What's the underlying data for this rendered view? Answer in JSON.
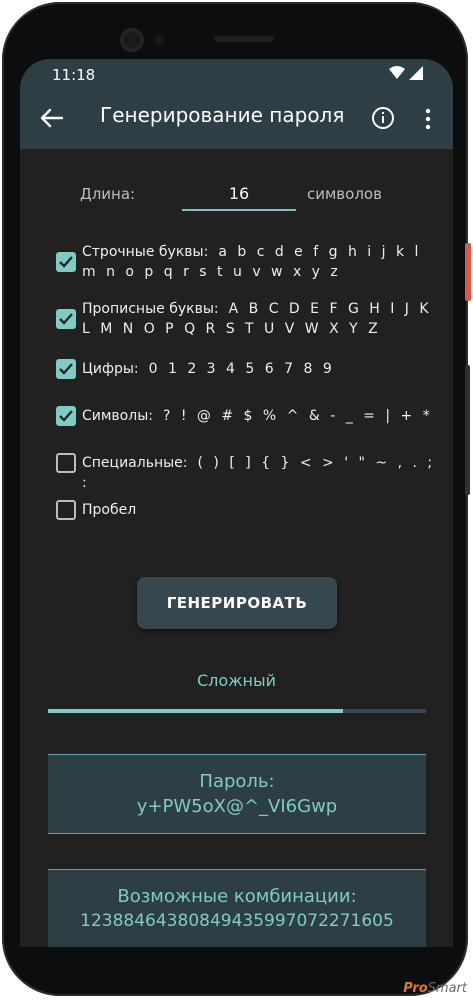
{
  "status_bar": {
    "time": "11:18"
  },
  "app_bar": {
    "title": "Генерирование пароля"
  },
  "length": {
    "label": "Длина:",
    "value": "16",
    "suffix": "символов"
  },
  "options": [
    {
      "label": "Строчные буквы:",
      "chars": "a b c d e f g h i j k l m n o p q r s t u v w x y z",
      "checked": true
    },
    {
      "label": "Прописные буквы:",
      "chars": "A B C D E F G H I J K L M N O P Q R S T U V W X Y Z",
      "checked": true
    },
    {
      "label": "Цифры:",
      "chars": "0 1 2 3 4 5 6 7 8 9",
      "checked": true
    },
    {
      "label": "Символы:",
      "chars": "? ! @ # $ % ^ & - _ = | + *",
      "checked": true
    },
    {
      "label": "Специальные:",
      "chars": "( ) [ ] { } < > ' \" ~ , . ; :",
      "checked": false
    },
    {
      "label": "Пробел",
      "chars": "",
      "checked": false
    }
  ],
  "generate_button": {
    "label": "ГЕНЕРИРОВАТЬ"
  },
  "strength": {
    "label": "Сложный",
    "level": 0.78
  },
  "password": {
    "label": "Пароль:",
    "value": "y+PW5oX@^_VI6Gwp"
  },
  "combinations": {
    "label": "Возможные комбинации:",
    "value": "12388464380849435997072271605"
  },
  "watermark": {
    "brand_a": "Pro",
    "brand_b": "Smart"
  },
  "colors": {
    "accent": "#80cbc4",
    "appbar": "#2d3e45",
    "background": "#212121"
  }
}
